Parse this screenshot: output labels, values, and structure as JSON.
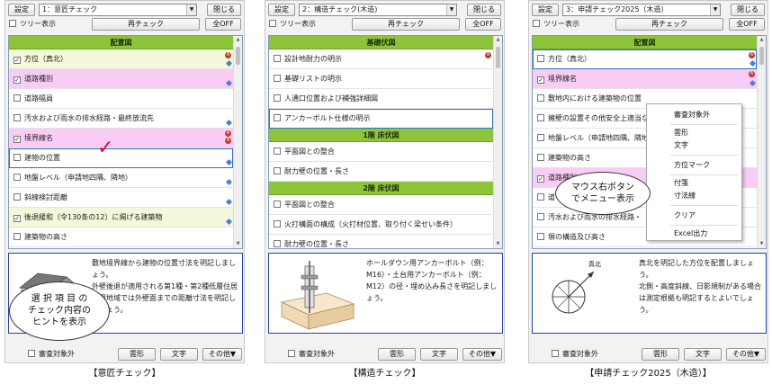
{
  "captions": [
    "【意匠チェック】",
    "【構造チェック】",
    "【申請チェック2025（木造）】"
  ],
  "common": {
    "settings": "設定",
    "close": "閉じる",
    "tree_view": "ツリー表示",
    "recheck": "再チェック",
    "all_off": "全OFF",
    "exclude": "審査対象外",
    "cloud": "雲形",
    "text": "文字",
    "other": "その他▼"
  },
  "p1": {
    "select": "1：意匠チェック",
    "header": "配置図",
    "items": [
      {
        "label": "方位（真北）",
        "checked": "✓"
      },
      {
        "label": "道路種別",
        "checked": "✓"
      },
      {
        "label": "道路幅員",
        "checked": ""
      },
      {
        "label": "汚水および雨水の排水経路・最終放流先",
        "checked": ""
      },
      {
        "label": "境界線名",
        "checked": "✓"
      },
      {
        "label": "建物の位置",
        "checked": ""
      },
      {
        "label": "地盤レベル（申請地四隅、隣地）",
        "checked": ""
      },
      {
        "label": "斜線検討距離",
        "checked": ""
      },
      {
        "label": "後退緩和（令130条の12）に掲げる建築物",
        "checked": "✓"
      },
      {
        "label": "建築物の高さ",
        "checked": ""
      }
    ],
    "hint": "敷地境界線から建物の位置寸法を明記しましょう。\n外壁後退が適用される第1種・第2種低層住居専用地域では外壁面までの距離寸法を明記しましょう。",
    "bubble": "選 択 項 目 の\nチェック内容の\nヒントを表示"
  },
  "p2": {
    "select": "2：構造チェック(木造)",
    "sections": [
      {
        "header": "基礎伏図",
        "items": [
          "設計地耐力の明示",
          "基礎リストの明示",
          "人通口位置および補強詳細図",
          "アンカーボルト仕様の明示"
        ]
      },
      {
        "header": "1階 床伏図",
        "items": [
          "平面図との整合",
          "耐力壁の位置・長さ"
        ]
      },
      {
        "header": "2階 床伏図",
        "items": [
          "平面図との整合",
          "火打構面の構成（火打材位置、取り付く梁せい条件）",
          "耐力壁の位置・長さ"
        ]
      }
    ],
    "hint": "ホールダウン用アンカーボルト（例：M16）・土台用アンカーボルト（例：M12）の径・埋め込み長さを明記しましょう。"
  },
  "p3": {
    "select": "3：申請チェック2025（木造）",
    "header": "配置図",
    "items": [
      {
        "label": "方位（真北）",
        "checked": ""
      },
      {
        "label": "境界線名",
        "checked": "✓"
      },
      {
        "label": "敷地内における建築物の位置",
        "checked": ""
      },
      {
        "label": "擁壁の設置その他安全上適当な",
        "checked": ""
      },
      {
        "label": "地盤レベル（申請地四隅、隣地",
        "checked": ""
      },
      {
        "label": "建築物の高さ",
        "checked": ""
      },
      {
        "label": "道路種別",
        "checked": "✓"
      },
      {
        "label": "道",
        "checked": ""
      },
      {
        "label": "汚水および雨水の排水経路・",
        "checked": ""
      },
      {
        "label": "塀の構造及び高さ",
        "checked": ""
      }
    ],
    "hint": "真北を明記した方位を配置しましょう。\n北側・高度斜線、日影規制がある場合は測定根拠も明記するとよいでしょう。",
    "north_label": "真北",
    "bubble": "マウス右ボタン\nでメニュー表示",
    "menu": [
      "審査対象外",
      "雲形",
      "文字",
      "方位マーク",
      "付箋",
      "寸法線",
      "クリア",
      "Excel出力"
    ]
  }
}
